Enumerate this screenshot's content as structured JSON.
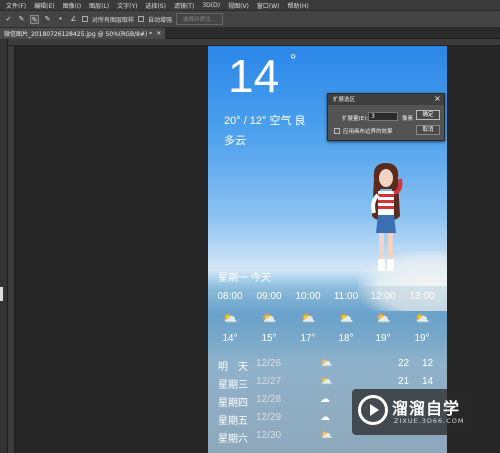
{
  "menu": [
    "文件(F)",
    "编辑(E)",
    "图像(I)",
    "图层(L)",
    "文字(Y)",
    "选择(S)",
    "滤镜(T)",
    "3D(D)",
    "视图(V)",
    "窗口(W)",
    "帮助(H)"
  ],
  "options_bar": {
    "sample_all_layers": "对所有图层取样",
    "auto_enhance": "自动增强",
    "select_subject": "选择并遮住..."
  },
  "document_tab": {
    "title": "微信图片_20180726128425.jpg @ 50%(RGB/8#) *",
    "close": "×"
  },
  "weather": {
    "temp": "14",
    "deg": "°",
    "range_quality": "20° / 12°  空气 良",
    "condition": "多云",
    "today_label": "星期一   今天",
    "hours": [
      {
        "time": "08:00",
        "temp": "14°"
      },
      {
        "time": "09:00",
        "temp": "15°"
      },
      {
        "time": "10:00",
        "temp": "17°"
      },
      {
        "time": "11:00",
        "temp": "18°"
      },
      {
        "time": "12:00",
        "temp": "19°"
      },
      {
        "time": "13:00",
        "temp": "19°"
      }
    ],
    "days": [
      {
        "name": "明　天",
        "date": "12/26",
        "hi": "22",
        "lo": "12"
      },
      {
        "name": "星期三",
        "date": "12/27",
        "hi": "21",
        "lo": "14"
      },
      {
        "name": "星期四",
        "date": "12/28",
        "hi": "",
        "lo": ""
      },
      {
        "name": "星期五",
        "date": "12/29",
        "hi": "",
        "lo": ""
      },
      {
        "name": "星期六",
        "date": "12/30",
        "hi": "",
        "lo": ""
      }
    ]
  },
  "dialog": {
    "title": "扩展选区",
    "close": "×",
    "label": "扩展量(E):",
    "value": "3",
    "unit": "像素",
    "checkbox_label": "应用画布边界的效果",
    "ok": "确定",
    "cancel": "取消"
  },
  "watermark": {
    "title": "溜溜自学",
    "subtitle": "ZIXUE.3D66.COM"
  },
  "colors": {
    "sky": "#2a86e8",
    "dialog_bg": "#535353",
    "app_bg": "#262626"
  }
}
